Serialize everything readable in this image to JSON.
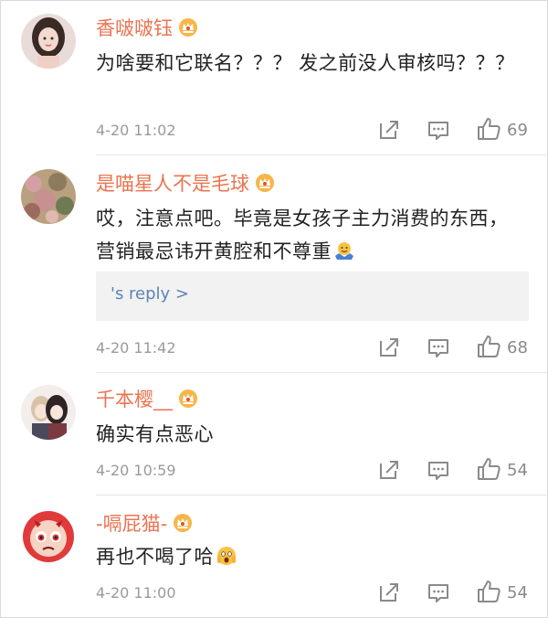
{
  "comments": [
    {
      "username": "香啵啵钰",
      "text": "为啥要和它联名？？？ 发之前没人审核吗？？？",
      "time": "4-20 11:02",
      "likes": "69"
    },
    {
      "username": "是喵星人不是毛球",
      "text": "哎，注意点吧。毕竟是女孩子主力消费的东西，营销最忌讳开黄腔和不尊重",
      "reply_link": "'s reply >",
      "time": "4-20 11:42",
      "likes": "68"
    },
    {
      "username": "千本樱__",
      "text": "确实有点恶心",
      "time": "4-20 10:59",
      "likes": "54"
    },
    {
      "username": "-嗝屁猫-",
      "text": "再也不喝了哈",
      "time": "4-20 11:00",
      "likes": "54"
    }
  ],
  "colors": {
    "username": "#eb7350",
    "reply_link": "#5d83b8",
    "meta": "#9a9a9a"
  },
  "icons": [
    "vip-crown-badge",
    "share-icon",
    "comment-icon",
    "thumbs-up-icon",
    "shrug-emoji",
    "scared-emoji"
  ]
}
